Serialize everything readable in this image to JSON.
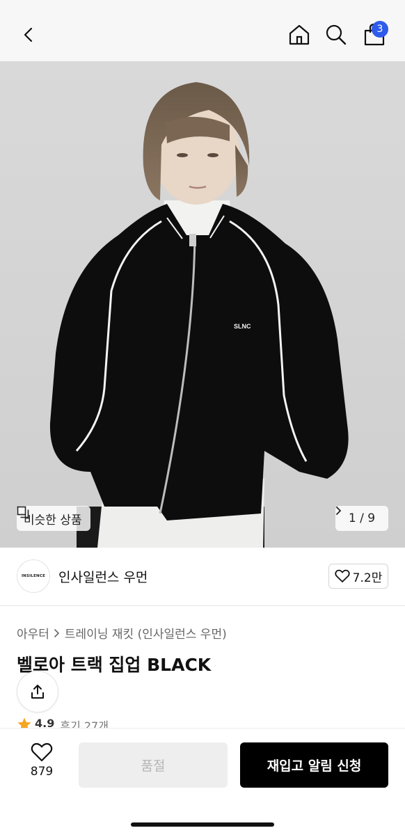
{
  "header": {
    "back_icon": "chevron-left-icon",
    "home_icon": "home-icon",
    "search_icon": "search-icon",
    "cart_icon": "shopping-bag-icon",
    "cart_count": "3",
    "badge_color": "#2f5bea"
  },
  "hero": {
    "similar_label": "비슷한 상품",
    "pager": "1 / 9",
    "logo_text": "SLNC"
  },
  "brand": {
    "logo_text": "INSILENCE",
    "name": "인사일런스 우먼",
    "like_count": "7.2만"
  },
  "product": {
    "breadcrumb": [
      "아우터",
      "트레이닝 재킷 (인사일런스 우먼)"
    ],
    "title": "벨로아 트랙 집업 BLACK",
    "rating": "4.9",
    "review_label": "후기 27개",
    "star_color": "#f5a623"
  },
  "bottom": {
    "wish_count": "879",
    "soldout_label": "품절",
    "restock_label": "재입고 알림 신청"
  }
}
